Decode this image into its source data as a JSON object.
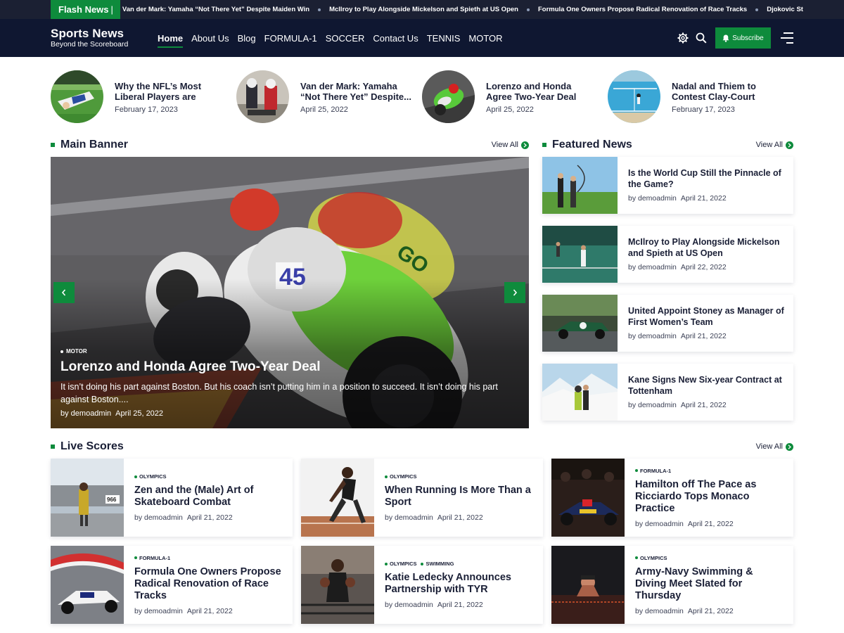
{
  "ticker": {
    "label": "Flash News",
    "items": [
      "Van der Mark: Yamaha “Not There Yet” Despite Maiden Win",
      "McIlroy to Play Alongside Mickelson and Spieth at US Open",
      "Formula One Owners Propose Radical Renovation of Race Tracks",
      "Djokovic St"
    ]
  },
  "header": {
    "logo_title": "Sports News",
    "logo_tagline": "Beyond the Scoreboard",
    "nav": [
      "Home",
      "About Us",
      "Blog",
      "FORMULA-1",
      "SOCCER",
      "Contact Us",
      "TENNIS",
      "MOTOR"
    ],
    "active_nav": "Home",
    "subscribe_label": "Subscribe"
  },
  "trending": [
    {
      "title": "Why the NFL’s Most Liberal Players are Struggling to...",
      "date": "February 17, 2023"
    },
    {
      "title": "Van der Mark: Yamaha “Not There Yet” Despite...",
      "date": "April 25, 2022"
    },
    {
      "title": "Lorenzo and Honda Agree Two-Year Deal",
      "date": "April 25, 2022"
    },
    {
      "title": "Nadal and Thiem to Contest Clay-Court Crow...",
      "date": "February 17, 2023"
    }
  ],
  "main_banner": {
    "section_title": "Main Banner",
    "view_all": "View All",
    "category": "MOTOR",
    "title": "Lorenzo and Honda Agree Two-Year Deal",
    "excerpt": "It isn’t doing his part against Boston. But his coach isn’t putting him in a position to succeed. It isn’t doing his part against Boston....",
    "author": "by demoadmin",
    "date": "April 25, 2022"
  },
  "featured": {
    "section_title": "Featured News",
    "view_all": "View All",
    "items": [
      {
        "title": "Is the World Cup Still the Pinnacle of the Game?",
        "author": "by demoadmin",
        "date": "April 21, 2022"
      },
      {
        "title": "McIlroy to Play Alongside Mickelson and Spieth at US Open",
        "author": "by demoadmin",
        "date": "April 22, 2022"
      },
      {
        "title": "United Appoint Stoney as Manager of First Women’s Team",
        "author": "by demoadmin",
        "date": "April 21, 2022"
      },
      {
        "title": "Kane Signs New Six-year Contract at Tottenham",
        "author": "by demoadmin",
        "date": "April 21, 2022"
      }
    ]
  },
  "live_scores": {
    "section_title": "Live Scores",
    "view_all": "View All",
    "items": [
      {
        "cats": [
          "OLYMPICS"
        ],
        "title": "Zen and the (Male) Art of Skateboard Combat",
        "author": "by demoadmin",
        "date": "April 21, 2022"
      },
      {
        "cats": [
          "OLYMPICS"
        ],
        "title": "When Running Is More Than a Sport",
        "author": "by demoadmin",
        "date": "April 21, 2022"
      },
      {
        "cats": [
          "FORMULA-1"
        ],
        "title": "Hamilton off The Pace as Ricciardo Tops Monaco Practice",
        "author": "by demoadmin",
        "date": "April 21, 2022"
      },
      {
        "cats": [
          "FORMULA-1"
        ],
        "title": "Formula One Owners Propose Radical Renovation of Race Tracks",
        "author": "by demoadmin",
        "date": "April 21, 2022"
      },
      {
        "cats": [
          "OLYMPICS",
          "SWIMMING"
        ],
        "title": "Katie Ledecky Announces Partnership with TYR",
        "author": "by demoadmin",
        "date": "April 21, 2022"
      },
      {
        "cats": [
          "OLYMPICS"
        ],
        "title": "Army-Navy Swimming & Diving Meet Slated for Thursday",
        "author": "by demoadmin",
        "date": "April 21, 2022"
      }
    ]
  },
  "colors": {
    "accent": "#0e8b3c",
    "header_bg": "#0f1731",
    "ticker_bg": "#1b2033"
  }
}
